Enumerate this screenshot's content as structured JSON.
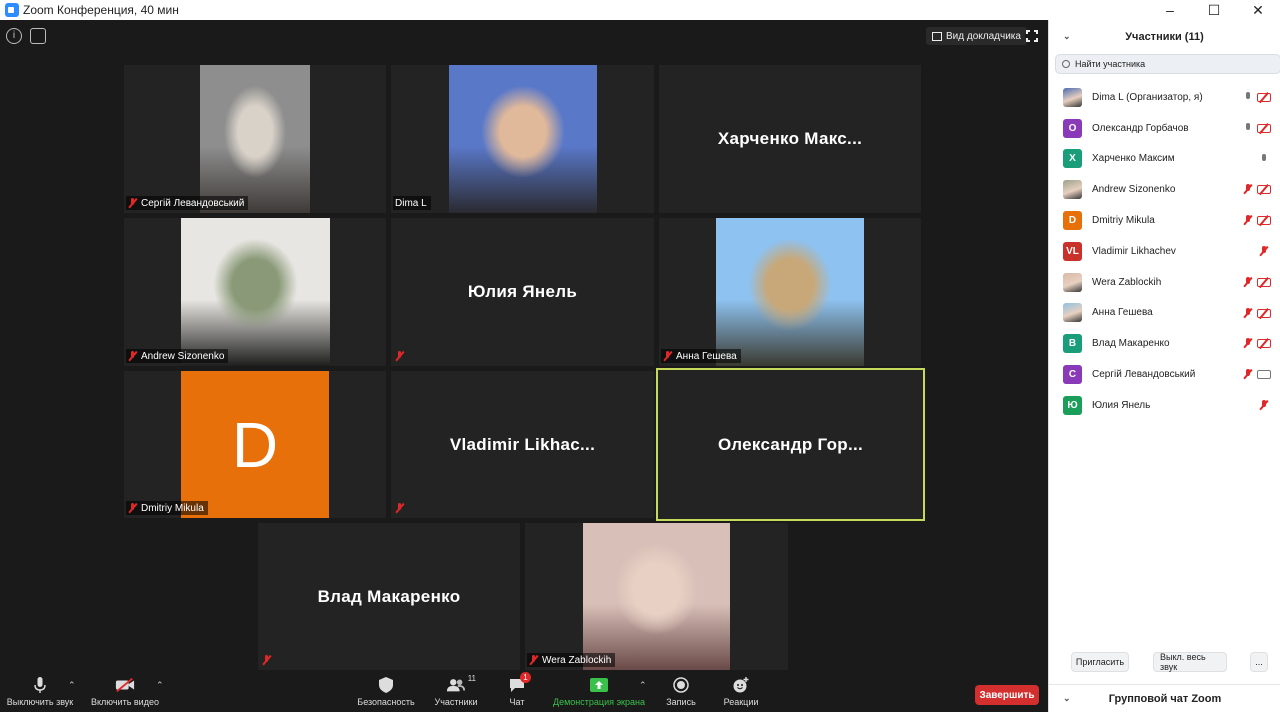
{
  "window": {
    "title": "Zoom Конференция, 40 мин",
    "minimize": "–",
    "maximize": "☐",
    "close": "✕"
  },
  "top": {
    "speaker_view": "Вид докладчика",
    "info_icon": "i"
  },
  "tiles": [
    {
      "id": "serhii",
      "label": "Сергій Левандовський",
      "muted": true,
      "kind": "photo",
      "colors": [
        "#8e8e8e",
        "#d9d2c8",
        "#3e3a38"
      ]
    },
    {
      "id": "dima",
      "label": "Dima L",
      "muted": false,
      "kind": "photo",
      "colors": [
        "#5a78c8",
        "#e0b89a",
        "#2a2a30"
      ]
    },
    {
      "id": "kharchenko",
      "name": "Харченко  Макс...",
      "kind": "name"
    },
    {
      "id": "andrew",
      "label": "Andrew Sizonenko",
      "muted": true,
      "kind": "photo",
      "colors": [
        "#e8e6e2",
        "#8a9a78",
        "#1e1e1e"
      ]
    },
    {
      "id": "yulia",
      "name": "Юлия Янель",
      "muted": true,
      "kind": "name"
    },
    {
      "id": "anna",
      "label": "Анна Гешева",
      "muted": true,
      "kind": "photo",
      "colors": [
        "#8ec2f0",
        "#c8a878",
        "#3a3a30"
      ]
    },
    {
      "id": "dmitriy",
      "label": "Dmitriy Mikula",
      "muted": true,
      "kind": "avatar",
      "letter": "D",
      "color": "#e8700a"
    },
    {
      "id": "vladimir",
      "name": "Vladimir  Likhac...",
      "muted": true,
      "kind": "name"
    },
    {
      "id": "oleksandr",
      "name": "Олександр  Гор...",
      "kind": "name",
      "active": true
    },
    {
      "id": "vlad",
      "name": "Влад Макаренко",
      "muted": true,
      "kind": "name"
    },
    {
      "id": "wera",
      "label": "Wera Zablockih",
      "muted": true,
      "kind": "photo",
      "colors": [
        "#d8c0b8",
        "#e8d0c4",
        "#6a4a48"
      ]
    }
  ],
  "toolbar": {
    "mute": "Выключить звук",
    "video": "Включить видео",
    "security": "Безопасность",
    "participants": "Участники",
    "participants_count": "11",
    "chat": "Чат",
    "chat_badge": "1",
    "share": "Демонстрация экрана",
    "record": "Запись",
    "reactions": "Реакции",
    "end": "Завершить"
  },
  "sidebar": {
    "title": "Участники (11)",
    "search_placeholder": "Найти участника",
    "participants": [
      {
        "name": "Dima L (Организатор, я)",
        "avatar": "",
        "avatar_color": "#4a6ab0",
        "photo": true,
        "mic": "on",
        "cam": "muted"
      },
      {
        "name": "Олександр Горбачов",
        "avatar": "О",
        "avatar_color": "#8a3ab9",
        "mic": "on",
        "cam": "muted"
      },
      {
        "name": "Харченко Максим",
        "avatar": "Х",
        "avatar_color": "#1a9e7a",
        "mic": "on",
        "cam": "none"
      },
      {
        "name": "Andrew Sizonenko",
        "avatar": "",
        "avatar_color": "#9aa08a",
        "photo": true,
        "mic": "muted",
        "cam": "muted"
      },
      {
        "name": "Dmitriy Mikula",
        "avatar": "D",
        "avatar_color": "#e8700a",
        "mic": "muted",
        "cam": "muted"
      },
      {
        "name": "Vladimir Likhachev",
        "avatar": "VL",
        "avatar_color": "#c8322a",
        "mic": "muted",
        "cam": "none"
      },
      {
        "name": "Wera Zablockih",
        "avatar": "",
        "avatar_color": "#d8b8a8",
        "photo": true,
        "mic": "muted",
        "cam": "muted"
      },
      {
        "name": "Анна Гешева",
        "avatar": "",
        "avatar_color": "#8ec2e0",
        "photo": true,
        "mic": "muted",
        "cam": "muted"
      },
      {
        "name": "Влад Макаренко",
        "avatar": "В",
        "avatar_color": "#1a9e7a",
        "mic": "muted",
        "cam": "muted"
      },
      {
        "name": "Сергій Левандовський",
        "avatar": "С",
        "avatar_color": "#8a3ab9",
        "mic": "muted",
        "cam": "on"
      },
      {
        "name": "Юлия Янель",
        "avatar": "Ю",
        "avatar_color": "#1a9e5a",
        "mic": "muted",
        "cam": "none"
      }
    ],
    "invite": "Пригласить",
    "mute_all": "Выкл. весь звук",
    "more": "...",
    "chat_title": "Групповой чат Zoom"
  }
}
